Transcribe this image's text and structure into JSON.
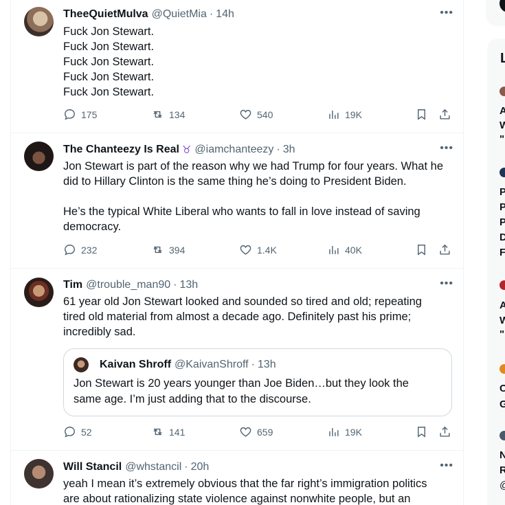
{
  "tweets": [
    {
      "name": "TheeQuietMulva",
      "handle": "@QuietMia",
      "time": "14h",
      "lines": [
        "Fuck Jon Stewart.",
        "Fuck Jon Stewart.",
        "Fuck Jon Stewart.",
        "Fuck Jon Stewart.",
        "Fuck Jon Stewart."
      ],
      "replies": "175",
      "retweets": "134",
      "likes": "540",
      "views": "19K"
    },
    {
      "name": "The Chanteezy Is Real",
      "badge": "♉",
      "handle": "@iamchanteezy",
      "time": "3h",
      "lines": [
        "Jon Stewart is part of the reason why we had Trump for four years. What he",
        "did to Hillary Clinton is the same thing he’s doing to President Biden.",
        "",
        "He’s the typical White Liberal who wants to fall in love instead of saving",
        "democracy."
      ],
      "replies": "232",
      "retweets": "394",
      "likes": "1.4K",
      "views": "40K"
    },
    {
      "name": "Tim",
      "handle": "@trouble_man90",
      "time": "13h",
      "lines": [
        "61 year old Jon Stewart looked and sounded so tired and old; repeating",
        "tired old material from almost a decade ago. Definitely past his prime;",
        "incredibly sad."
      ],
      "quote": {
        "name": "Kaivan Shroff",
        "handle": "@KaivanShroff",
        "time": "13h",
        "lines": [
          "Jon Stewart is 20 years younger than Joe Biden…but they look the",
          "same age. I’m just adding that to the discourse."
        ]
      },
      "replies": "52",
      "retweets": "141",
      "likes": "659",
      "views": "19K"
    },
    {
      "name": "Will Stancil",
      "handle": "@whstancil",
      "time": "20h",
      "lines": [
        "yeah I mean it’s extremely obvious that the far right’s immigration politics",
        "are about rationalizing state violence against nonwhite people, but an"
      ]
    }
  ],
  "more_label": "•••",
  "separator": "·",
  "sidebar": {
    "title": "L",
    "items": [
      {
        "lines": [
          "A",
          "W",
          "\""
        ]
      },
      {
        "lines": [
          "P",
          "P",
          "P",
          "D",
          "F"
        ]
      },
      {
        "lines": [
          "A",
          "W",
          "\""
        ]
      },
      {
        "lines": [
          "C",
          "G"
        ]
      },
      {
        "lines": [
          "N",
          "R",
          "@"
        ]
      }
    ]
  },
  "colors": {
    "text": "#0f1419",
    "muted": "#536471",
    "border": "#eff3f4",
    "quote_border": "#cfd9de",
    "badge": "#8a4fd8",
    "sidebar_bg": "#f7f9f9"
  },
  "icons": [
    "reply-icon",
    "retweet-icon",
    "like-icon",
    "views-icon",
    "bookmark-icon",
    "share-icon",
    "more-icon"
  ]
}
